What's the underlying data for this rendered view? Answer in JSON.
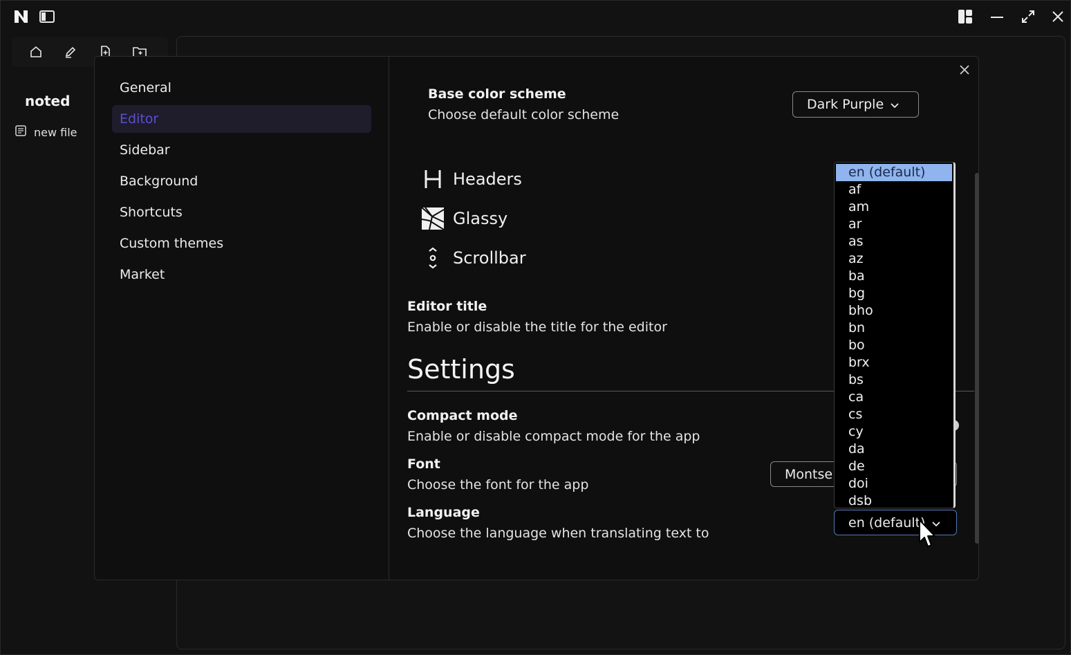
{
  "brand": "noted",
  "sidebar": {
    "file_item": "new file"
  },
  "modal": {
    "nav": [
      {
        "label": "General",
        "active": false
      },
      {
        "label": "Editor",
        "active": true
      },
      {
        "label": "Sidebar",
        "active": false
      },
      {
        "label": "Background",
        "active": false
      },
      {
        "label": "Shortcuts",
        "active": false
      },
      {
        "label": "Custom themes",
        "active": false
      },
      {
        "label": "Market",
        "active": false
      }
    ],
    "base_color": {
      "title": "Base color scheme",
      "desc": "Choose default color scheme",
      "value": "Dark Purple"
    },
    "features": [
      {
        "label": "Headers",
        "icon": "header-icon"
      },
      {
        "label": "Glassy",
        "icon": "glassy-icon"
      },
      {
        "label": "Scrollbar",
        "icon": "scrollbar-icon"
      }
    ],
    "editor_title": {
      "title": "Editor title",
      "desc": "Enable or disable the title for the editor"
    },
    "settings_heading": "Settings",
    "compact_mode": {
      "title": "Compact mode",
      "desc": "Enable or disable compact mode for the app"
    },
    "font": {
      "title": "Font",
      "desc": "Choose the font for the app",
      "value": "Montse"
    },
    "language": {
      "title": "Language",
      "desc": "Choose the language when translating text to",
      "value": "en (default)",
      "options": [
        "en (default)",
        "af",
        "am",
        "ar",
        "as",
        "az",
        "ba",
        "bg",
        "bho",
        "bn",
        "bo",
        "brx",
        "bs",
        "ca",
        "cs",
        "cy",
        "da",
        "de",
        "doi",
        "dsb"
      ]
    }
  },
  "colors": {
    "accent": "#5b4fcf",
    "active_bg": "#1f1d2b",
    "dropdown_selected": "#8fb4ee",
    "select_border_focus": "#5878b8"
  }
}
